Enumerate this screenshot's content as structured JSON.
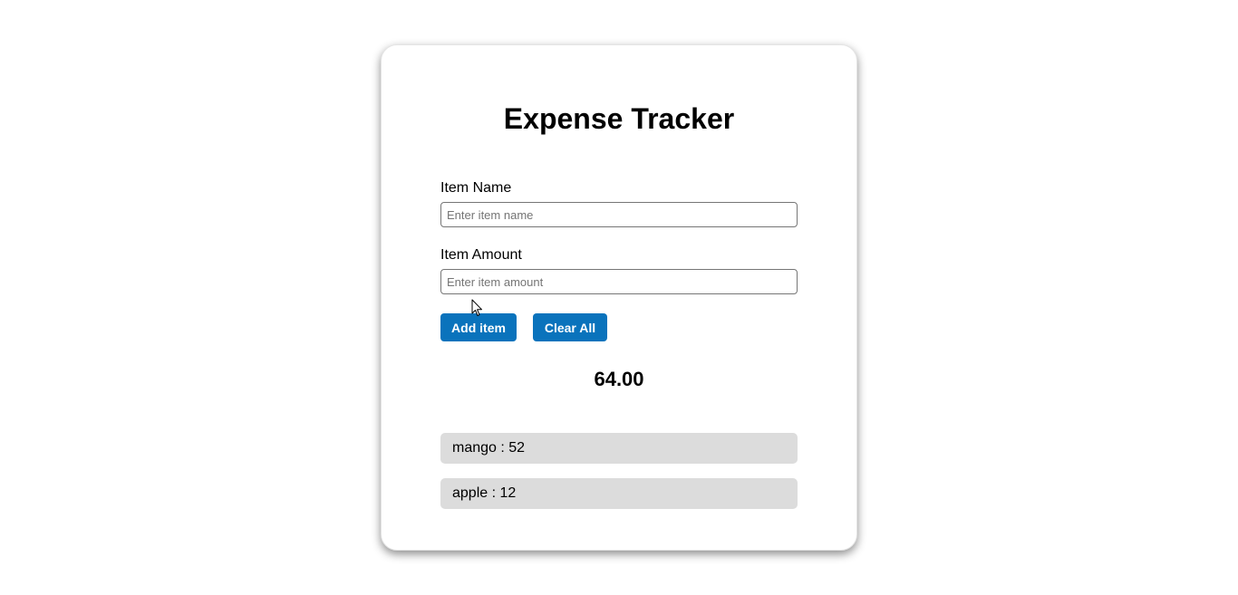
{
  "app": {
    "title": "Expense Tracker"
  },
  "form": {
    "name_label": "Item Name",
    "name_placeholder": "Enter item name",
    "name_value": "",
    "amount_label": "Item Amount",
    "amount_placeholder": "Enter item amount",
    "amount_value": ""
  },
  "buttons": {
    "add_label": "Add item",
    "clear_label": "Clear All"
  },
  "total": "64.00",
  "items": [
    {
      "text": "mango : 52"
    },
    {
      "text": "apple : 12"
    }
  ],
  "colors": {
    "button_bg": "#0a73bc",
    "item_bg": "#dcdcdc"
  }
}
